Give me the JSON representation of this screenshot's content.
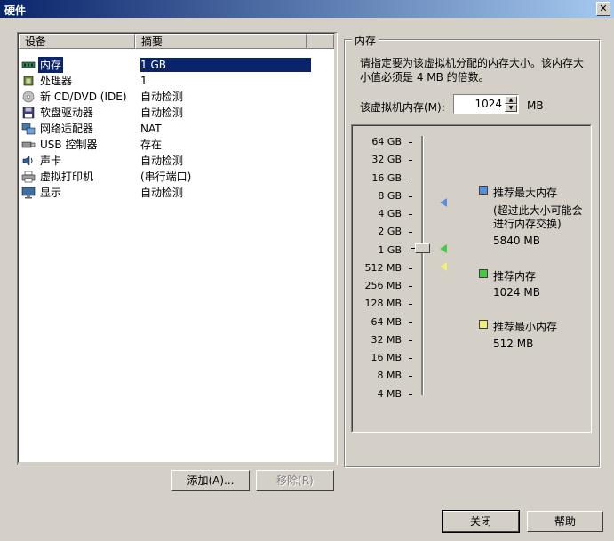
{
  "window": {
    "title": "硬件",
    "close_glyph": "✕"
  },
  "device_list": {
    "headers": {
      "device": "设备",
      "summary": "摘要"
    },
    "rows": [
      {
        "name": "内存",
        "summary": "1 GB",
        "icon": "memory-icon",
        "selected": true
      },
      {
        "name": "处理器",
        "summary": "1",
        "icon": "processor-icon"
      },
      {
        "name": "新 CD/DVD (IDE)",
        "summary": "自动检测",
        "icon": "cd-dvd-icon"
      },
      {
        "name": "软盘驱动器",
        "summary": "自动检测",
        "icon": "floppy-icon"
      },
      {
        "name": "网络适配器",
        "summary": "NAT",
        "icon": "network-icon"
      },
      {
        "name": "USB 控制器",
        "summary": "存在",
        "icon": "usb-icon"
      },
      {
        "name": "声卡",
        "summary": "自动检测",
        "icon": "sound-icon"
      },
      {
        "name": "虚拟打印机",
        "summary": "(串行端口)",
        "icon": "printer-icon"
      },
      {
        "name": "显示",
        "summary": "自动检测",
        "icon": "display-icon"
      }
    ]
  },
  "buttons": {
    "add": "添加(A)...",
    "remove": "移除(R)",
    "close": "关闭",
    "help": "帮助"
  },
  "memory_panel": {
    "group_title": "内存",
    "description": "请指定要为该虚拟机分配的内存大小。该内存大小值必须是 4 MB 的倍数。",
    "memory_label": "该虚拟机内存(M):",
    "memory_value": "1024",
    "unit": "MB",
    "scale_ticks": [
      "64 GB",
      "32 GB",
      "16 GB",
      "8 GB",
      "4 GB",
      "2 GB",
      "1 GB",
      "512 MB",
      "256 MB",
      "128 MB",
      "64 MB",
      "32 MB",
      "16 MB",
      "8 MB",
      "4 MB"
    ],
    "slider_value_mb": 1024,
    "legend": {
      "max": {
        "title": "推荐最大内存",
        "note": "(超过此大小可能会进行内存交换)",
        "value": "5840 MB",
        "color": "#5b8fd6"
      },
      "recommended": {
        "title": "推荐内存",
        "value": "1024 MB",
        "color": "#46c846"
      },
      "min": {
        "title": "推荐最小内存",
        "value": "512 MB",
        "color": "#f0f078"
      }
    }
  }
}
